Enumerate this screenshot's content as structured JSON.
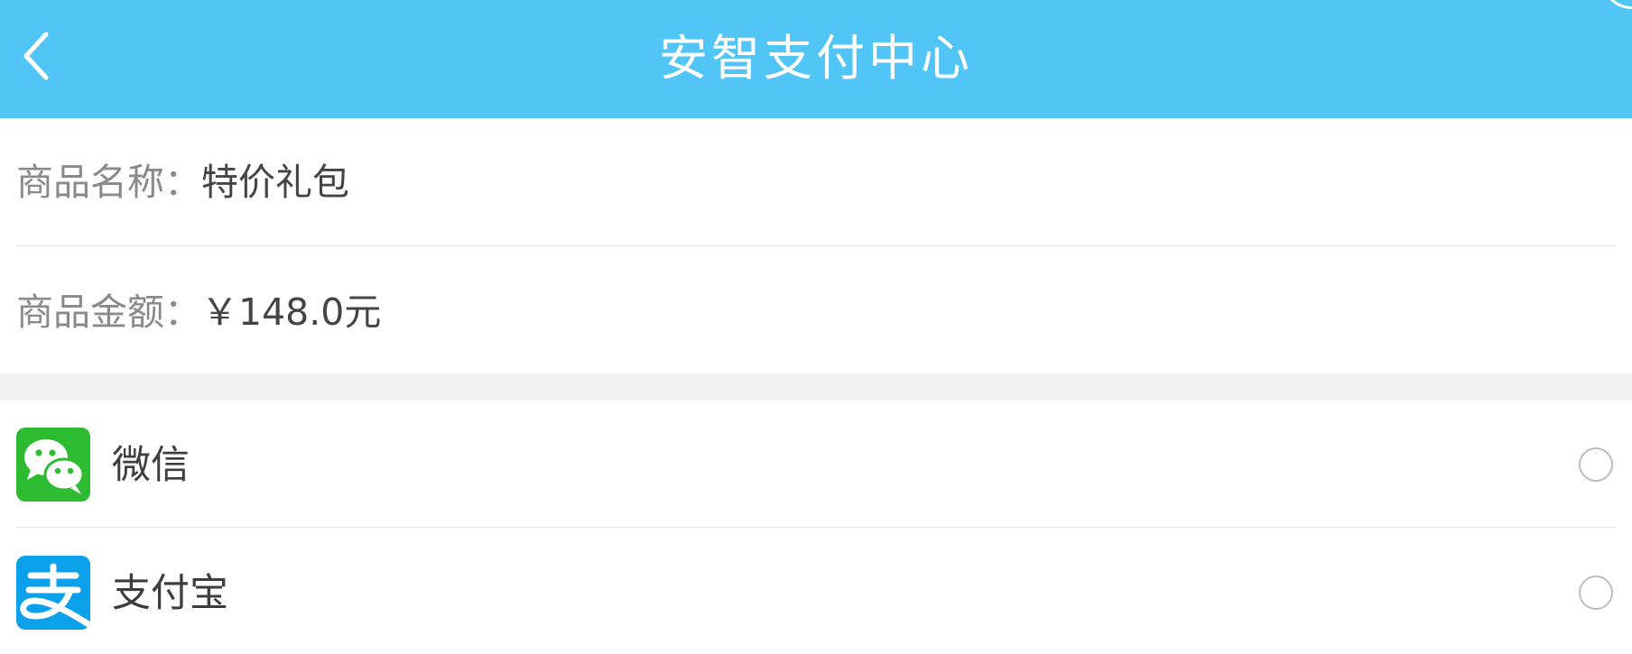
{
  "header": {
    "title": "安智支付中心",
    "back_icon": "chevron-left-icon",
    "background_color": "#52c5f7"
  },
  "order": {
    "name_label": "商品名称：",
    "name_value": "特价礼包",
    "amount_label": "商品金额：",
    "amount_value": "￥148.0元"
  },
  "payment_methods": [
    {
      "label": "微信",
      "icon": "wechat-icon",
      "color": "#2dbb32",
      "selected": false
    },
    {
      "label": "支付宝",
      "icon": "alipay-icon",
      "color": "#0aa0ea",
      "selected": false
    }
  ]
}
